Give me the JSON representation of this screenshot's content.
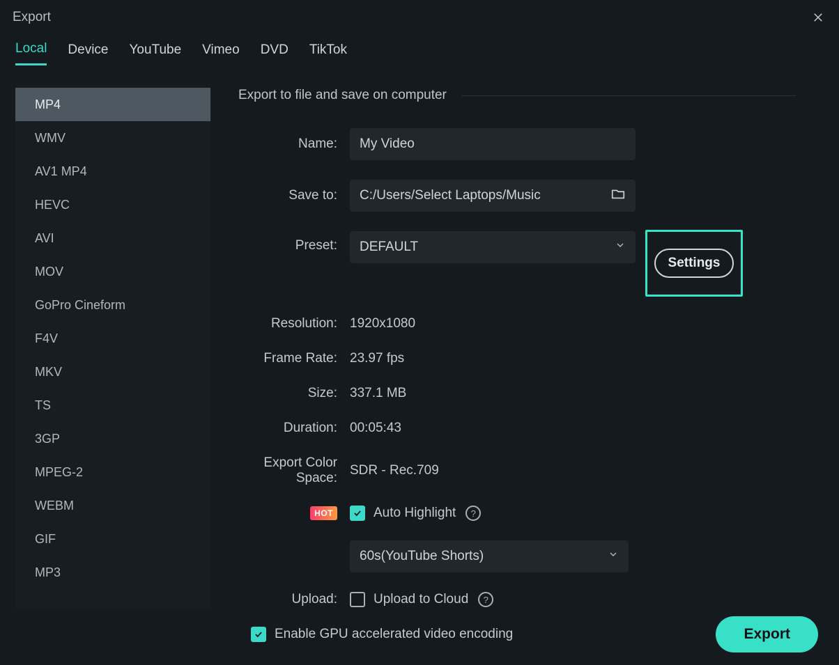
{
  "title": "Export",
  "tabs": [
    "Local",
    "Device",
    "YouTube",
    "Vimeo",
    "DVD",
    "TikTok"
  ],
  "active_tab": "Local",
  "formats": [
    "MP4",
    "WMV",
    "AV1 MP4",
    "HEVC",
    "AVI",
    "MOV",
    "GoPro Cineform",
    "F4V",
    "MKV",
    "TS",
    "3GP",
    "MPEG-2",
    "WEBM",
    "GIF",
    "MP3"
  ],
  "active_format": "MP4",
  "section_heading": "Export to file and save on computer",
  "labels": {
    "name": "Name:",
    "save_to": "Save to:",
    "preset": "Preset:",
    "resolution": "Resolution:",
    "frame_rate": "Frame Rate:",
    "size": "Size:",
    "duration": "Duration:",
    "color_space": "Export Color Space:",
    "upload": "Upload:"
  },
  "values": {
    "name": "My Video",
    "save_to": "C:/Users/Select Laptops/Music",
    "preset": "DEFAULT",
    "resolution": "1920x1080",
    "frame_rate": "23.97 fps",
    "size": "337.1 MB",
    "duration": "00:05:43",
    "color_space": "SDR - Rec.709",
    "highlight_preset": "60s(YouTube Shorts)"
  },
  "settings_button": "Settings",
  "hot_badge": "HOT",
  "auto_highlight_label": "Auto Highlight",
  "upload_cloud_label": "Upload to Cloud",
  "gpu_label": "Enable GPU accelerated video encoding",
  "export_button": "Export",
  "checks": {
    "auto_highlight": true,
    "upload_cloud": false,
    "gpu": true
  }
}
